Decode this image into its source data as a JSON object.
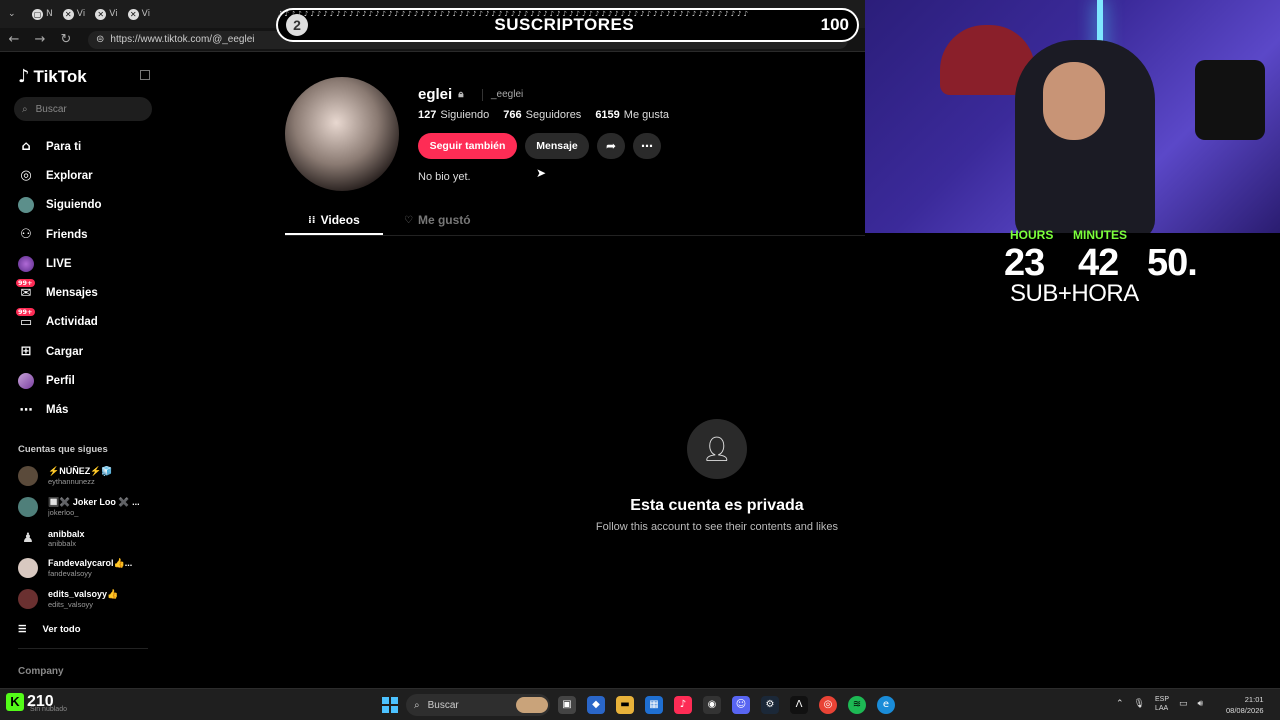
{
  "browser": {
    "tabs": [
      "N",
      "Vi",
      "Vi",
      "Vi"
    ],
    "url": "https://www.tiktok.com/@_eeglei"
  },
  "goal": {
    "start": "2",
    "title": "SUSCRIPTORES",
    "end": "100"
  },
  "sidebar": {
    "logo": "TikTok",
    "search_placeholder": "Buscar",
    "items": [
      {
        "label": "Para ti",
        "icon": "home-icon"
      },
      {
        "label": "Explorar",
        "icon": "compass-icon"
      },
      {
        "label": "Siguiendo",
        "icon": "following-avatar-icon"
      },
      {
        "label": "Friends",
        "icon": "friends-icon"
      },
      {
        "label": "LIVE",
        "icon": "live-icon"
      },
      {
        "label": "Mensajes",
        "icon": "messages-icon",
        "badge": "99+"
      },
      {
        "label": "Actividad",
        "icon": "activity-icon",
        "badge": "99+"
      },
      {
        "label": "Cargar",
        "icon": "upload-icon"
      },
      {
        "label": "Perfil",
        "icon": "profile-icon"
      },
      {
        "label": "Más",
        "icon": "more-icon"
      }
    ],
    "following_header": "Cuentas que sigues",
    "accounts": [
      {
        "name": "⚡NÚÑEZ⚡🧊",
        "user": "eythannunezz"
      },
      {
        "name": "🔲✖️ Joker Loo ✖️ ...",
        "user": "jokerloo_"
      },
      {
        "name": "anibbalx",
        "user": "anibbalx"
      },
      {
        "name": "Fandevalycarol👍...",
        "user": "fandevalsoyy"
      },
      {
        "name": "edits_valsoyy👍",
        "user": "edits_valsoyy"
      }
    ],
    "see_all": "Ver todo",
    "company": "Company"
  },
  "profile": {
    "username": "eglei",
    "handle": "_eeglei",
    "following_count": "127",
    "following_label": "Siguiendo",
    "followers_count": "766",
    "followers_label": "Seguidores",
    "likes_count": "6159",
    "likes_label": "Me gusta",
    "follow_back": "Seguir también",
    "message": "Mensaje",
    "bio": "No bio yet.",
    "tab_videos": "Videos",
    "tab_liked": "Me gustó",
    "private_title": "Esta cuenta es privada",
    "private_sub": "Follow this account to see their contents and likes"
  },
  "timer": {
    "hours_label": "HOURS",
    "minutes_label": "MINUTES",
    "hours": "23",
    "minutes": "42",
    "seconds": "50.",
    "sub_label": "SUB+HORA"
  },
  "taskbar": {
    "kick_count": "210",
    "kick_sub": "Sin nublado",
    "search": "Buscar",
    "lang_top": "ESP",
    "lang_bottom": "LAA",
    "time": "21:01",
    "date": "08/08/2026"
  }
}
